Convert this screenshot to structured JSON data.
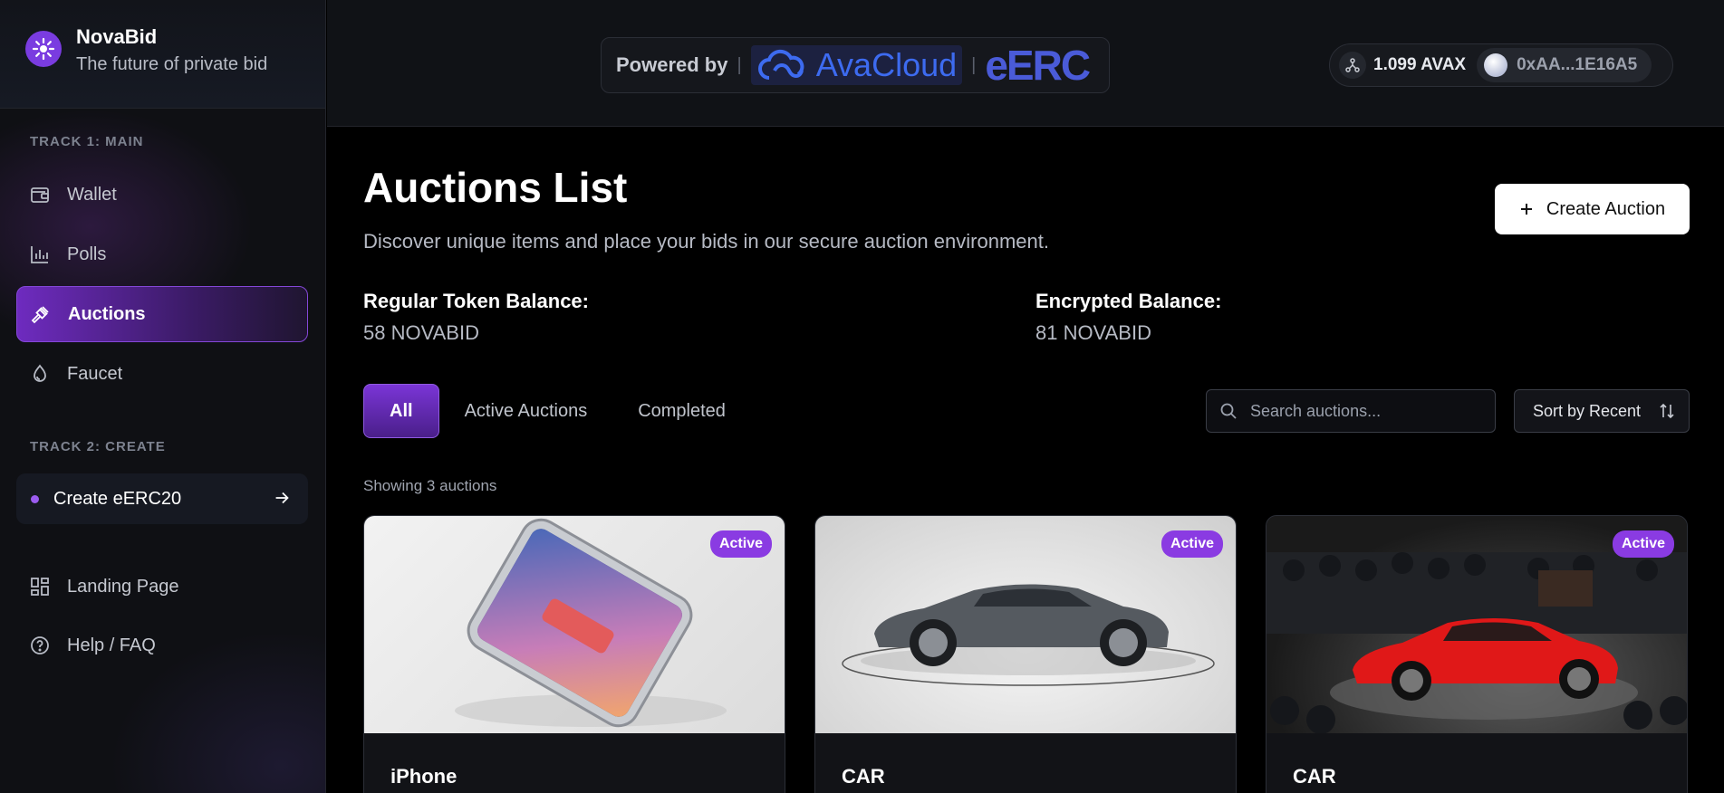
{
  "brand": {
    "name": "NovaBid",
    "tagline": "The future of private bid"
  },
  "sidebar": {
    "track1": "TRACK 1: MAIN",
    "items": [
      {
        "label": "Wallet",
        "icon": "wallet-icon"
      },
      {
        "label": "Polls",
        "icon": "bar-chart-icon"
      },
      {
        "label": "Auctions",
        "icon": "gavel-icon",
        "active": true
      },
      {
        "label": "Faucet",
        "icon": "droplet-icon"
      }
    ],
    "track2": "TRACK 2: CREATE",
    "create_erc": "Create eERC20",
    "bottom_items": [
      {
        "label": "Landing Page",
        "icon": "grid-icon"
      },
      {
        "label": "Help / FAQ",
        "icon": "help-icon"
      }
    ]
  },
  "header": {
    "powered_by": "Powered by",
    "avacloud": "AvaCloud",
    "eerc": "eERC",
    "balance": "1.099 AVAX",
    "address": "0xAA...1E16A5"
  },
  "main": {
    "title": "Auctions List",
    "description": "Discover unique items and place your bids in our secure auction environment.",
    "create_button": "Create Auction",
    "regular_label": "Regular Token Balance:",
    "regular_value": "58 NOVABID",
    "encrypted_label": "Encrypted Balance:",
    "encrypted_value": "81 NOVABID",
    "tabs": [
      "All",
      "Active Auctions",
      "Completed"
    ],
    "search_placeholder": "Search auctions...",
    "sort_label": "Sort by Recent",
    "showing": "Showing 3 auctions",
    "cards": [
      {
        "title": "iPhone",
        "badge": "Active"
      },
      {
        "title": "CAR",
        "badge": "Active"
      },
      {
        "title": "CAR",
        "badge": "Active"
      }
    ]
  },
  "colors": {
    "accent": "#8a3be2",
    "background": "#000000",
    "sidebar": "#0f1014"
  }
}
